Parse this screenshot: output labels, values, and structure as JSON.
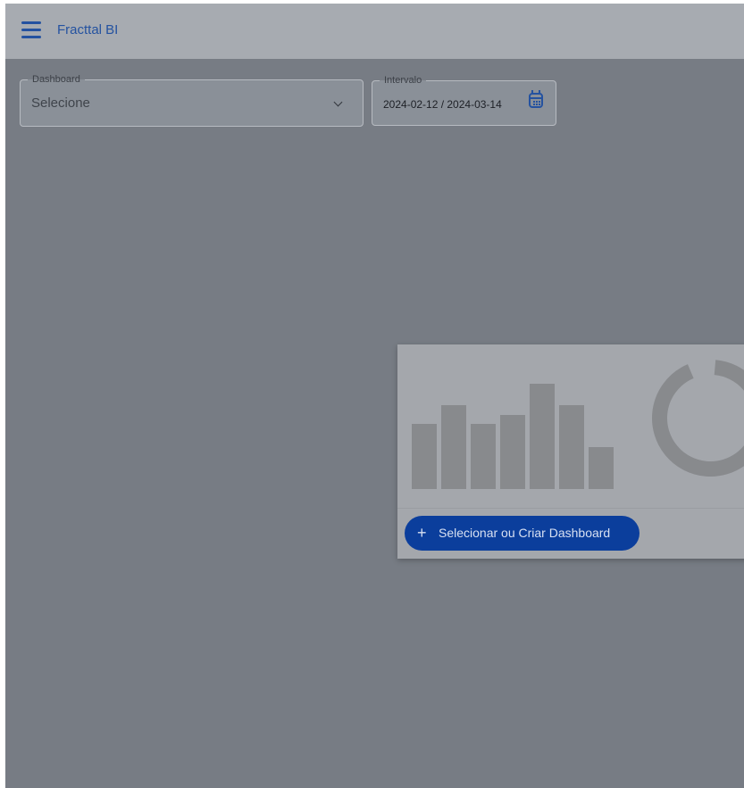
{
  "header": {
    "menu_icon": "hamburger-menu-icon",
    "title": "Fracttal BI"
  },
  "filters": {
    "dashboard": {
      "label": "Dashboard",
      "value": "Selecione"
    },
    "interval": {
      "label": "Intervalo",
      "value": "2024-02-12 / 2024-03-14",
      "icon": "calendar-icon"
    }
  },
  "empty_state": {
    "illustration_bars": [
      0.62,
      0.8,
      0.62,
      0.7,
      1.0,
      0.8,
      0.4
    ],
    "button_label": "Selecionar ou Criar Dashboard",
    "button_icon": "plus-icon"
  },
  "colors": {
    "accent": "#2452a0",
    "button": "#0b3e9c"
  }
}
